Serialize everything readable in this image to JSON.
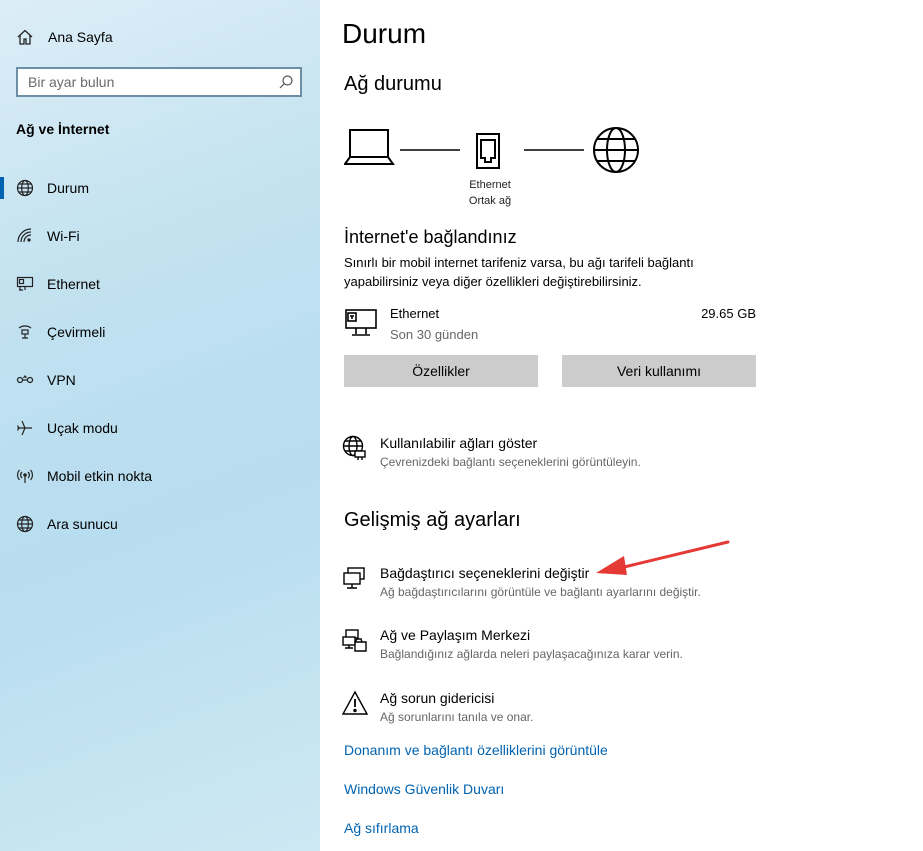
{
  "sidebar": {
    "home_label": "Ana Sayfa",
    "search_placeholder": "Bir ayar bulun",
    "section_title": "Ağ ve İnternet",
    "items": [
      {
        "label": "Durum",
        "icon": "globe-icon",
        "active": true
      },
      {
        "label": "Wi-Fi",
        "icon": "wifi-icon",
        "active": false
      },
      {
        "label": "Ethernet",
        "icon": "ethernet-icon",
        "active": false
      },
      {
        "label": "Çevirmeli",
        "icon": "dialup-icon",
        "active": false
      },
      {
        "label": "VPN",
        "icon": "vpn-icon",
        "active": false
      },
      {
        "label": "Uçak modu",
        "icon": "airplane-icon",
        "active": false
      },
      {
        "label": "Mobil etkin nokta",
        "icon": "hotspot-icon",
        "active": false
      },
      {
        "label": "Ara sunucu",
        "icon": "globe-icon",
        "active": false
      }
    ]
  },
  "main": {
    "title": "Durum",
    "network_status_heading": "Ağ durumu",
    "diagram": {
      "adapter_label": "Ethernet",
      "network_label": "Ortak ağ"
    },
    "connected_heading": "İnternet'e bağlandınız",
    "connected_desc_line1": "Sınırlı bir mobil internet tarifeniz varsa, bu ağı tarifeli bağlantı",
    "connected_desc_line2": "yapabilirsiniz veya diğer özellikleri değiştirebilirsiniz.",
    "usage": {
      "name": "Ethernet",
      "period": "Son 30 günden",
      "amount": "29.65 GB"
    },
    "buttons": {
      "properties": "Özellikler",
      "data_usage": "Veri kullanımı"
    },
    "show_networks": {
      "title": "Kullanılabilir ağları göster",
      "subtitle": "Çevrenizdeki bağlantı seçeneklerini görüntüleyin."
    },
    "advanced_heading": "Gelişmiş ağ ayarları",
    "advanced": [
      {
        "title": "Bağdaştırıcı seçeneklerini değiştir",
        "subtitle": "Ağ bağdaştırıcılarını görüntüle ve bağlantı ayarlarını değiştir.",
        "icon": "adapter-icon"
      },
      {
        "title": "Ağ ve Paylaşım Merkezi",
        "subtitle": "Bağlandığınız ağlarda neleri paylaşacağınıza karar verin.",
        "icon": "sharing-center-icon"
      },
      {
        "title": "Ağ sorun gidericisi",
        "subtitle": "Ağ sorunlarını tanıla ve onar.",
        "icon": "warning-icon"
      }
    ],
    "links": [
      "Donanım ve bağlantı özelliklerini görüntüle",
      "Windows Güvenlik Duvarı",
      "Ağ sıfırlama"
    ]
  },
  "colors": {
    "accent": "#0063b1",
    "link": "#0063b1",
    "annotation_arrow": "#e53935",
    "button_bg": "#cccccc"
  }
}
